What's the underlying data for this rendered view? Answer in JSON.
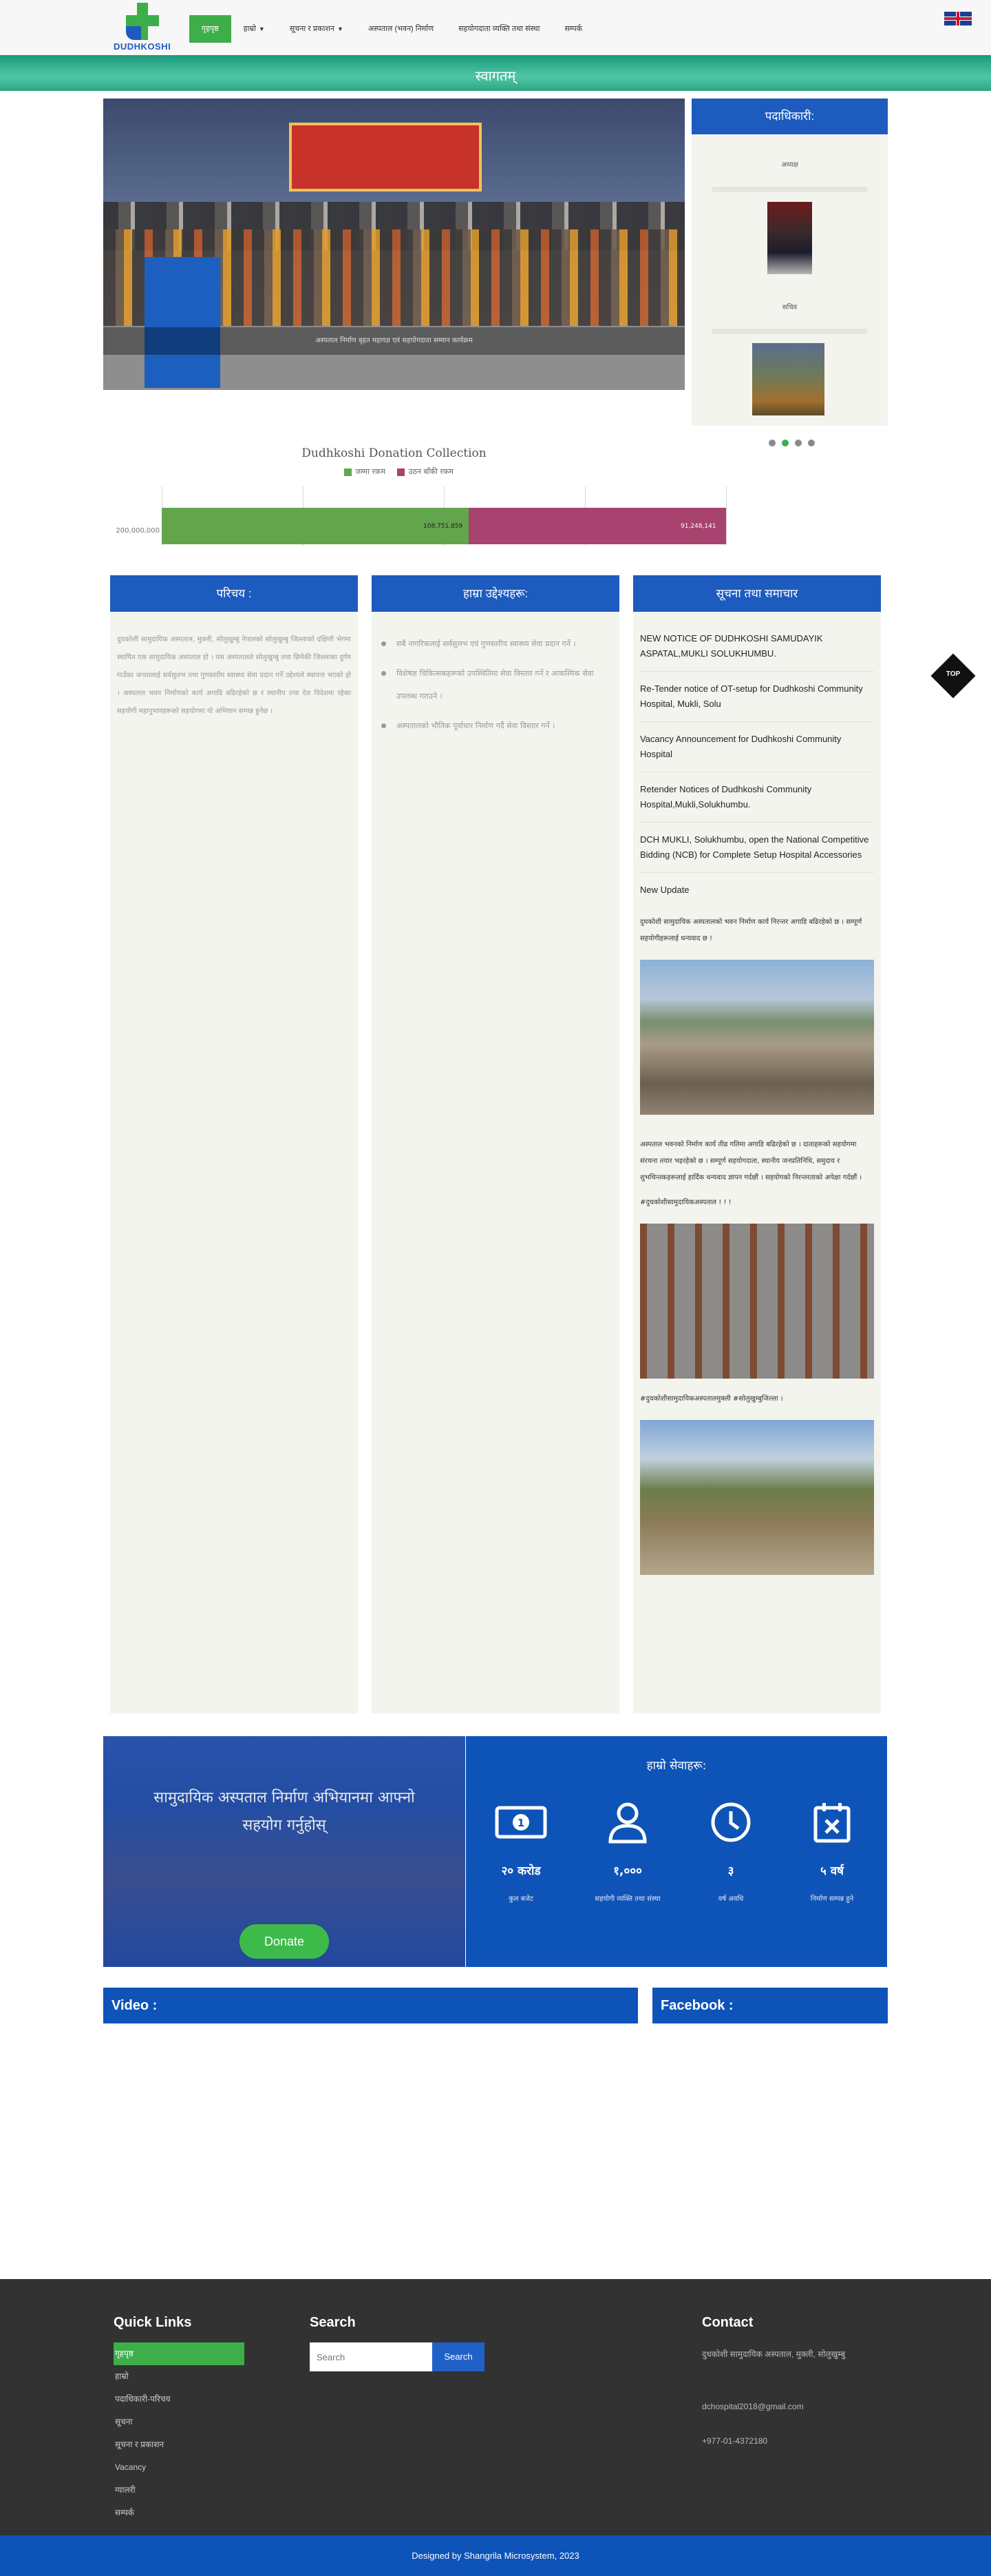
{
  "header": {
    "logo_text": "DUDHKOSHI",
    "nav": [
      {
        "label": "गृहपृष्ठ",
        "active": true,
        "dropdown": false
      },
      {
        "label": "हाम्रो",
        "active": false,
        "dropdown": true
      },
      {
        "label": "सूचना र प्रकाशन",
        "active": false,
        "dropdown": true
      },
      {
        "label": "अस्पताल (भवन) निर्माण",
        "active": false,
        "dropdown": false
      },
      {
        "label": "सहयोगदाता व्यक्ति तथा संस्था",
        "active": false,
        "dropdown": false
      },
      {
        "label": "सम्पर्क",
        "active": false,
        "dropdown": false
      }
    ],
    "language_flag": "uk-flag-icon"
  },
  "band": {
    "title": "स्वागतम्"
  },
  "slider": {
    "caption": "अस्पताल निर्माण बृहत महायज्ञ एवं सहयोगदाता सम्मान कार्यक्रम"
  },
  "staff": {
    "title": "पदाधिकारी:",
    "members": [
      {
        "role": "अध्यक्ष"
      },
      {
        "role": "सचिव"
      }
    ]
  },
  "donation_chart": {
    "chart_data": {
      "type": "bar",
      "orientation": "horizontal-stacked",
      "title": "Dudhkoshi Donation Collection",
      "series": [
        {
          "name": "जम्मा रकम",
          "values": [
            108751859
          ],
          "color": "#63a54d"
        },
        {
          "name": "उठन बाँकी रकम",
          "values": [
            91248141
          ],
          "color": "#a8436f"
        }
      ],
      "value_labels": [
        "108,751,859",
        "91,248,141"
      ],
      "axis_label": "200,000,000",
      "xlim": [
        0,
        200000000
      ],
      "grid": true,
      "legend": "top"
    }
  },
  "columns": {
    "intro_title": "परिचय :",
    "intro_text": "दुधकोशी सामुदायिक अस्पताल, मुक्ली, सोलुखुम्बु नेपालको सोलुखुम्बु जिल्लाको दक्षिणी भेगमा स्थापित एक सामुदायिक अस्पताल हो । यस अस्पतालले सोलुखुम्बु तथा छिमेकी जिल्लाका दुर्गम गाउँका जनतालाई सर्वसुलभ तथा गुणस्तरीय स्वास्थ्य सेवा प्रदान गर्ने उद्देश्यले स्थापना भएको हो । अस्पताल भवन निर्माणको कार्य अगाडि बढिरहेको छ र स्थानीय तथा देश विदेशमा रहेका सहयोगी महानुभावहरूको सहयोगमा यो अभियान सम्पन्न हुनेछ ।",
    "goals_title": "हाम्रा उद्देश्यहरू:",
    "goals": [
      "सबै नागरिकलाई सर्वसुलभ एवं गुणस्तरीय स्वास्थ्य सेवा प्रदान गर्ने ।",
      "विशेषज्ञ चिकित्सकहरूको उपस्थितिमा सेवा विस्तार गर्ने र आकस्मिक सेवा उपलब्ध गराउने ।",
      "अस्पतालको भौतिक पूर्वाधार निर्माण गर्दै सेवा विस्तार गर्ने ।"
    ],
    "news_title": "सूचना तथा समाचार",
    "news": [
      "NEW NOTICE OF DUDHKOSHI SAMUDAYIK ASPATAL,MUKLI SOLUKHUMBU.",
      "Re-Tender notice of OT-setup for Dudhkoshi Community Hospital, Mukli, Solu",
      "Vacancy Announcement for Dudhkoshi Community Hospital",
      "Retender Notices of Dudhkoshi Community Hospital,Mukli,Solukhumbu.",
      "DCH MUKLI, Solukhumbu, open the National Competitive Bidding (NCB) for Complete Setup Hospital Accessories"
    ],
    "update_title": "New Update",
    "update_text_1": "दुधकोशी सामुदायिक अस्पतालको भवन निर्माण कार्य निरन्तर अगाडि बढिरहेको छ । सम्पूर्ण सहयोगीहरूलाई धन्यवाद छ !",
    "update_text_2": "अस्पताल भवनको निर्माण कार्य तीव्र गतिमा अगाडि बढिरहेको छ । दाताहरूको सहयोगमा संरचना तयार भइरहेको छ । सम्पूर्ण सहयोगदाता, स्थानीय जनप्रतिनिधि, समुदाय र शुभचिन्तकहरूलाई हार्दिक धन्यवाद ज्ञापन गर्दछौं । सहयोगको निरन्तरताको अपेक्षा गर्दछौं ।",
    "hashtag_1": "#दुधकोशीसामुदायिकअस्पताल ! ! !",
    "hashtag_2": "#दुधकोशीसामुदायिकअस्पतालमुक्ली #सोलुखुम्बुजिल्ला ।"
  },
  "donate": {
    "text": "सामुदायिक अस्पताल निर्माण अभियानमा आफ्नो सहयोग गर्नुहोस्",
    "button_label": "Donate"
  },
  "stats": {
    "title": "हाम्रो सेवाहरू:",
    "items": [
      {
        "icon": "money-icon",
        "value": "२० करोड",
        "label": "कुल बजेट"
      },
      {
        "icon": "user-icon",
        "value": "१,०००",
        "label": "सहयोगी व्यक्ति तथा संस्था"
      },
      {
        "icon": "clock-icon",
        "value": "३",
        "label": "वर्ष अवधि"
      },
      {
        "icon": "calendar-icon",
        "value": "५ वर्ष",
        "label": "निर्माण सम्पन्न हुने"
      }
    ]
  },
  "video": {
    "title": "Video :"
  },
  "facebook": {
    "title": "Facebook :"
  },
  "footer": {
    "quick_links_title": "Quick Links",
    "quick_links": [
      "गृहपृष्ठ",
      "हाम्रो",
      "पदाधिकारी-परिचय",
      "सूचना",
      "सूचना र प्रकाशन",
      "Vacancy",
      "ग्यालरी",
      "सम्पर्क"
    ],
    "search_title": "Search",
    "search_placeholder": "Search",
    "search_button": "Search",
    "contact_title": "Contact",
    "address": "दुधकोशी सामुदायिक अस्पताल, मुक्ली, सोलुखुम्बु",
    "email": "dchospital2018@gmail.com",
    "phone": "+977-01-4372180",
    "credit": "Designed by Shangrila Microsystem, 2023"
  },
  "top_button": "TOP",
  "colors": {
    "blue": "#1d5bbe",
    "green": "#3dae49",
    "footer": "#323232"
  }
}
